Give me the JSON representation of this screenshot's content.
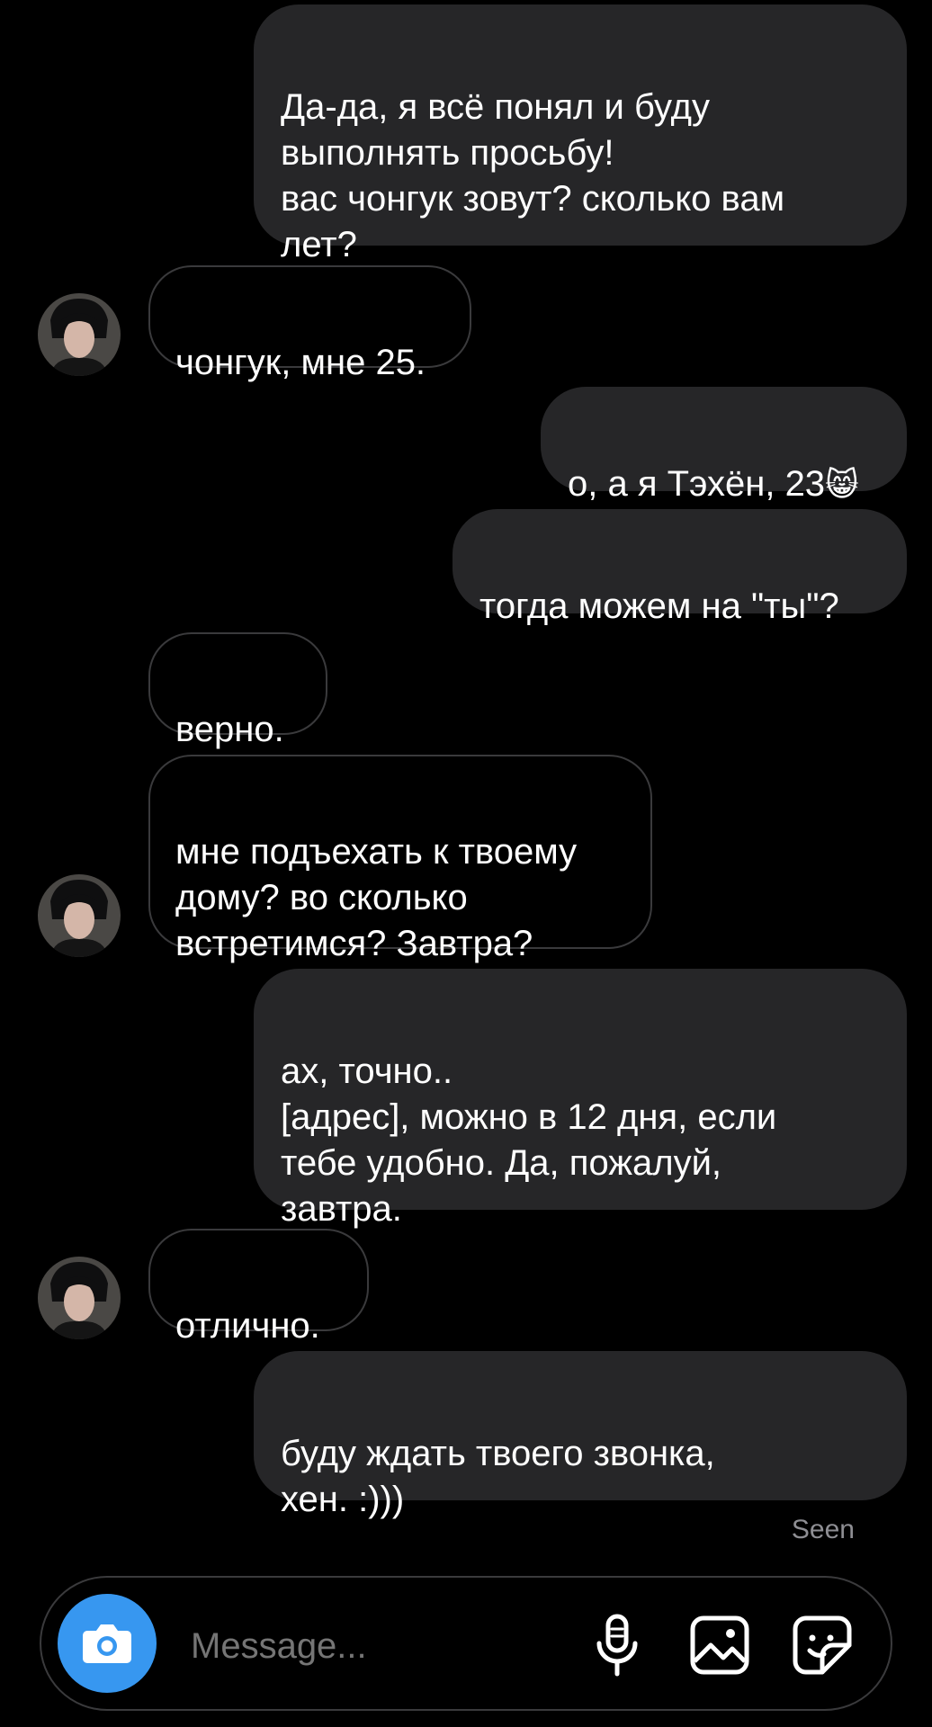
{
  "thread": {
    "messages": [
      {
        "side": "out",
        "text": "Да-да, я всё понял и буду\nвыполнять просьбу!\nвас чонгук зовут? сколько вам\nлет?"
      },
      {
        "side": "in",
        "text": "чонгук, мне 25."
      },
      {
        "side": "out",
        "text": "о, а я Тэхён, 23",
        "emoji": "😸"
      },
      {
        "side": "out",
        "text": "тогда можем на \"ты\"?"
      },
      {
        "side": "in",
        "text": "верно."
      },
      {
        "side": "in",
        "text": "мне подъехать к твоему\nдому? во сколько\nвстретимся? Завтра?"
      },
      {
        "side": "out",
        "text": "ах, точно..\n[адрес], можно в 12 дня, если\nтебе удобно. Да, пожалуй,\nзавтра."
      },
      {
        "side": "in",
        "text": "отлично."
      },
      {
        "side": "out",
        "text": "буду ждать твоего звонка,\nхен. :)))"
      }
    ],
    "seen_label": "Seen"
  },
  "composer": {
    "placeholder": "Message...",
    "icons": [
      "camera-icon",
      "microphone-icon",
      "gallery-icon",
      "sticker-icon"
    ]
  },
  "colors": {
    "background": "#000000",
    "outgoing_bubble": "#262628",
    "incoming_border": "#3a3a3c",
    "camera_button": "#3797f0",
    "muted_text": "#8e8e93"
  }
}
